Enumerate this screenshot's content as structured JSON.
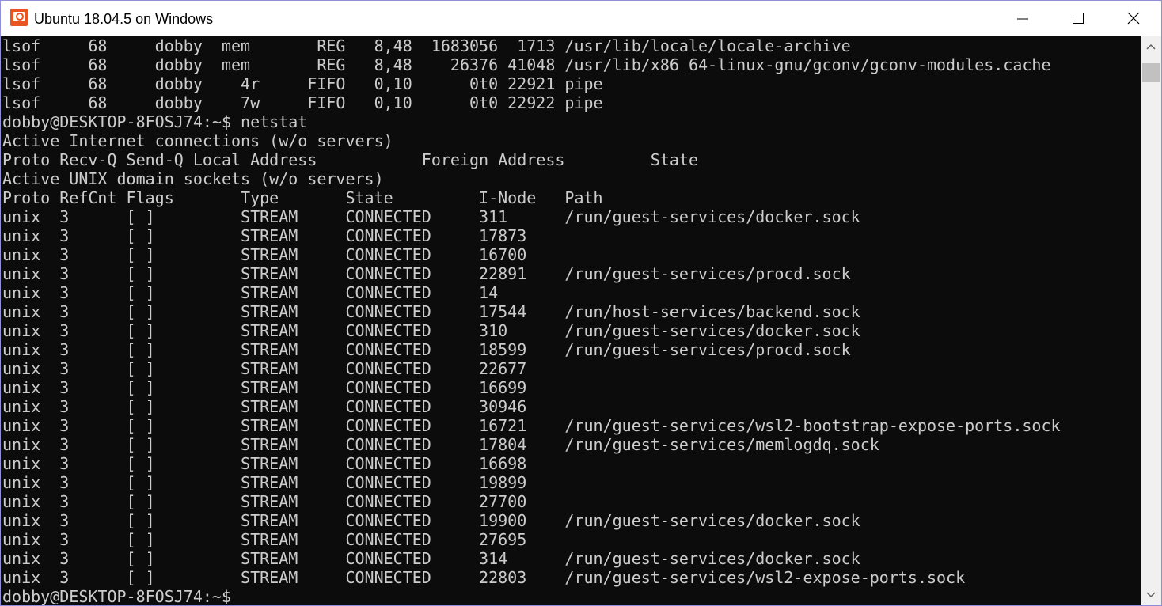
{
  "window": {
    "title": "Ubuntu 18.04.5 on Windows",
    "icon": "ubuntu-app-icon",
    "controls": {
      "minimize": "minimize-icon",
      "maximize": "maximize-icon",
      "close": "close-icon"
    }
  },
  "colors": {
    "terminal_background": "#0c0c0c",
    "terminal_text": "#cccccc",
    "accent": "#e95420"
  },
  "terminal": {
    "lines": [
      "lsof     68     dobby  mem       REG   8,48  1683056  1713 /usr/lib/locale/locale-archive",
      "lsof     68     dobby  mem       REG   8,48    26376 41048 /usr/lib/x86_64-linux-gnu/gconv/gconv-modules.cache",
      "lsof     68     dobby    4r     FIFO   0,10      0t0 22921 pipe",
      "lsof     68     dobby    7w     FIFO   0,10      0t0 22922 pipe",
      "dobby@DESKTOP-8FOSJ74:~$ netstat",
      "Active Internet connections (w/o servers)",
      "Proto Recv-Q Send-Q Local Address           Foreign Address         State",
      "Active UNIX domain sockets (w/o servers)",
      "Proto RefCnt Flags       Type       State         I-Node   Path",
      "unix  3      [ ]         STREAM     CONNECTED     311      /run/guest-services/docker.sock",
      "unix  3      [ ]         STREAM     CONNECTED     17873",
      "unix  3      [ ]         STREAM     CONNECTED     16700",
      "unix  3      [ ]         STREAM     CONNECTED     22891    /run/guest-services/procd.sock",
      "unix  3      [ ]         STREAM     CONNECTED     14",
      "unix  3      [ ]         STREAM     CONNECTED     17544    /run/host-services/backend.sock",
      "unix  3      [ ]         STREAM     CONNECTED     310      /run/guest-services/docker.sock",
      "unix  3      [ ]         STREAM     CONNECTED     18599    /run/guest-services/procd.sock",
      "unix  3      [ ]         STREAM     CONNECTED     22677",
      "unix  3      [ ]         STREAM     CONNECTED     16699",
      "unix  3      [ ]         STREAM     CONNECTED     30946",
      "unix  3      [ ]         STREAM     CONNECTED     16721    /run/guest-services/wsl2-bootstrap-expose-ports.sock",
      "unix  3      [ ]         STREAM     CONNECTED     17804    /run/guest-services/memlogdq.sock",
      "unix  3      [ ]         STREAM     CONNECTED     16698",
      "unix  3      [ ]         STREAM     CONNECTED     19899",
      "unix  3      [ ]         STREAM     CONNECTED     27700",
      "unix  3      [ ]         STREAM     CONNECTED     19900    /run/guest-services/docker.sock",
      "unix  3      [ ]         STREAM     CONNECTED     27695",
      "unix  3      [ ]         STREAM     CONNECTED     314      /run/guest-services/docker.sock",
      "unix  3      [ ]         STREAM     CONNECTED     22803    /run/guest-services/wsl2-expose-ports.sock",
      "dobby@DESKTOP-8FOSJ74:~$"
    ]
  },
  "scrollbar": {
    "up": "scroll-up-arrow-icon",
    "down": "scroll-down-arrow-icon"
  }
}
